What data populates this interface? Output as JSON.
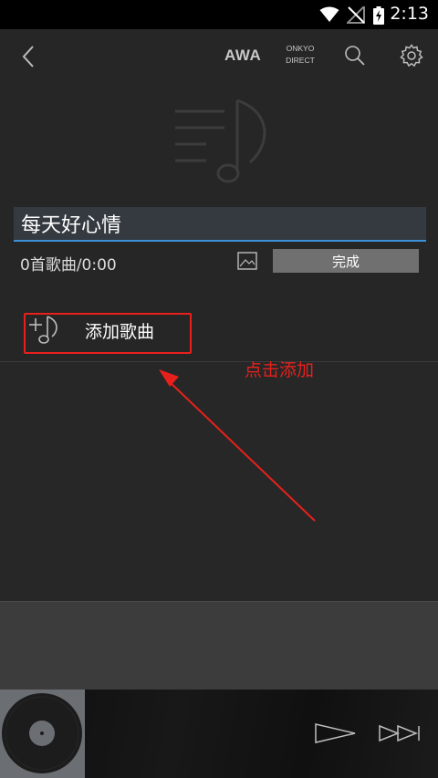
{
  "status_bar": {
    "time": "2:13",
    "icons": [
      "wifi-icon",
      "no-signal-icon",
      "battery-charging-icon"
    ]
  },
  "app_bar": {
    "back_icon": "chevron-left-icon",
    "awa_label": "AWA",
    "onkyo_line1": "ONKYO",
    "onkyo_line2": "DIRECT",
    "search_icon": "search-icon",
    "settings_icon": "gear-icon"
  },
  "playlist": {
    "artwork_icon": "playlist-music-icon",
    "title_value": "每天好心情",
    "song_count_text": "0首歌曲/0:00",
    "image_icon": "image-icon",
    "done_label": "完成"
  },
  "add_songs": {
    "icon": "add-music-icon",
    "label": "添加歌曲"
  },
  "annotation": {
    "text": "点击添加",
    "color": "#e8201c"
  },
  "player": {
    "disc_icon": "vinyl-disc-icon",
    "play_icon": "play-icon",
    "next_icon": "skip-next-icon"
  },
  "colors": {
    "background": "#262626",
    "accent_underline": "#3d8fd8",
    "done_button": "#707070"
  }
}
